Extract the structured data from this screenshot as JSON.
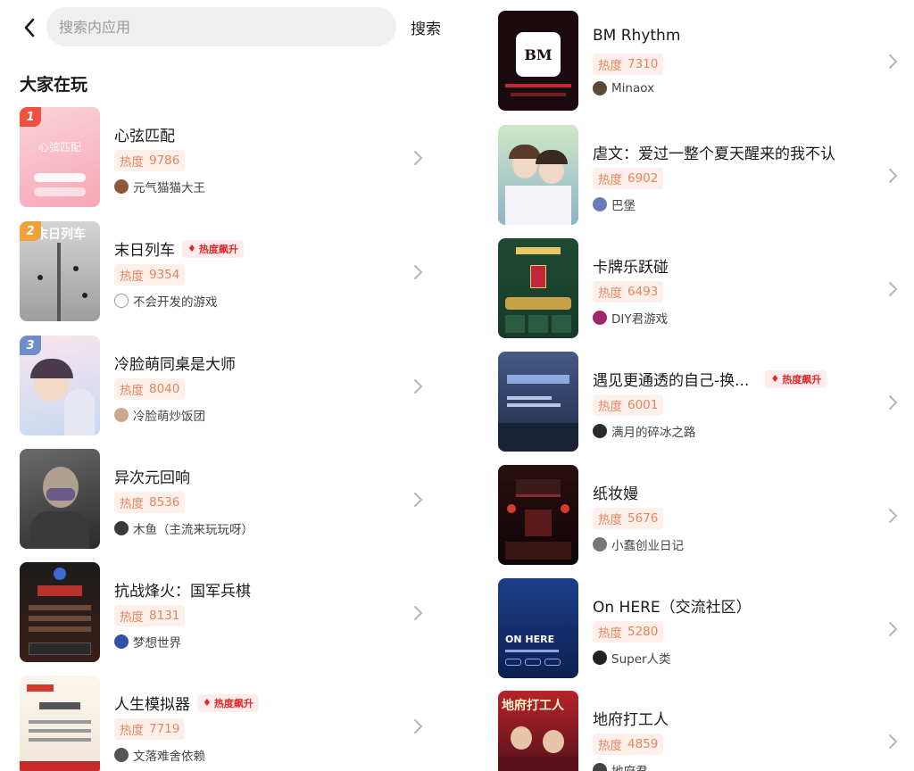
{
  "header": {
    "search_placeholder": "搜索内应用",
    "search_label": "搜索"
  },
  "section_title": "大家在玩",
  "heat_prefix": "热度",
  "hot_badge_label": "热度飙升",
  "colors": {
    "accent_heat_text": "#e5855e",
    "accent_heat_bg": "#fdf0ea",
    "hot_badge_text": "#e0292b",
    "rank_colors": [
      "#f0523e",
      "#f0a13a",
      "#6e8ec9"
    ]
  },
  "left_list": [
    {
      "rank": "1",
      "title": "心弦匹配",
      "heat": "9786",
      "author": "元气猫猫大王",
      "hot": false,
      "thumb_text": "心弦匹配",
      "avatar_color": "#8c5a3a"
    },
    {
      "rank": "2",
      "title": "末日列车",
      "heat": "9354",
      "author": "不会开发的游戏",
      "hot": true,
      "thumb_text": "末日列车",
      "avatar_color": "#cccccc"
    },
    {
      "rank": "3",
      "title": "冷脸萌同桌是大师",
      "heat": "8040",
      "author": "冷脸萌炒饭团",
      "hot": false,
      "thumb_text": "",
      "avatar_color": "#c9a88e"
    },
    {
      "rank": "",
      "title": "异次元回响",
      "heat": "8536",
      "author": "木鱼（主流来玩玩呀）",
      "hot": false,
      "thumb_text": "",
      "avatar_color": "#3b3b3b"
    },
    {
      "rank": "",
      "title": "抗战烽火：国军兵棋",
      "heat": "8131",
      "author": "梦想世界",
      "hot": false,
      "thumb_text": "",
      "avatar_color": "#3350a8"
    },
    {
      "rank": "",
      "title": "人生模拟器",
      "heat": "7719",
      "author": "文落难舍依赖",
      "hot": true,
      "thumb_text": "",
      "avatar_color": "#555555"
    }
  ],
  "right_list": [
    {
      "title": "BM Rhythm",
      "heat": "7310",
      "author": "Minaox",
      "hot": false,
      "thumb_text": "BM",
      "avatar_color": "#5a4a3a"
    },
    {
      "title": "虐文：爱过一整个夏天醒来的我不认",
      "heat": "6902",
      "author": "巴堡",
      "hot": false,
      "thumb_text": "",
      "avatar_color": "#6a7db8"
    },
    {
      "title": "卡牌乐跃碰",
      "heat": "6493",
      "author": "DIY君游戏",
      "hot": false,
      "thumb_text": "",
      "avatar_color": "#a0256b"
    },
    {
      "title": "遇见更通透的自己-换...",
      "heat": "6001",
      "author": "满月的碎冰之路",
      "hot": true,
      "thumb_text": "",
      "avatar_color": "#2c2c2c"
    },
    {
      "title": "纸妆嫚",
      "heat": "5676",
      "author": "小蠢创业日记",
      "hot": false,
      "thumb_text": "",
      "avatar_color": "#777777"
    },
    {
      "title": "On HERE（交流社区）",
      "heat": "5280",
      "author": "Super人类",
      "hot": false,
      "thumb_text": "ON HERE",
      "avatar_color": "#222222"
    },
    {
      "title": "地府打工人",
      "heat": "4859",
      "author": "地府君",
      "hot": false,
      "thumb_text": "地府打工人",
      "avatar_color": "#444444"
    }
  ]
}
